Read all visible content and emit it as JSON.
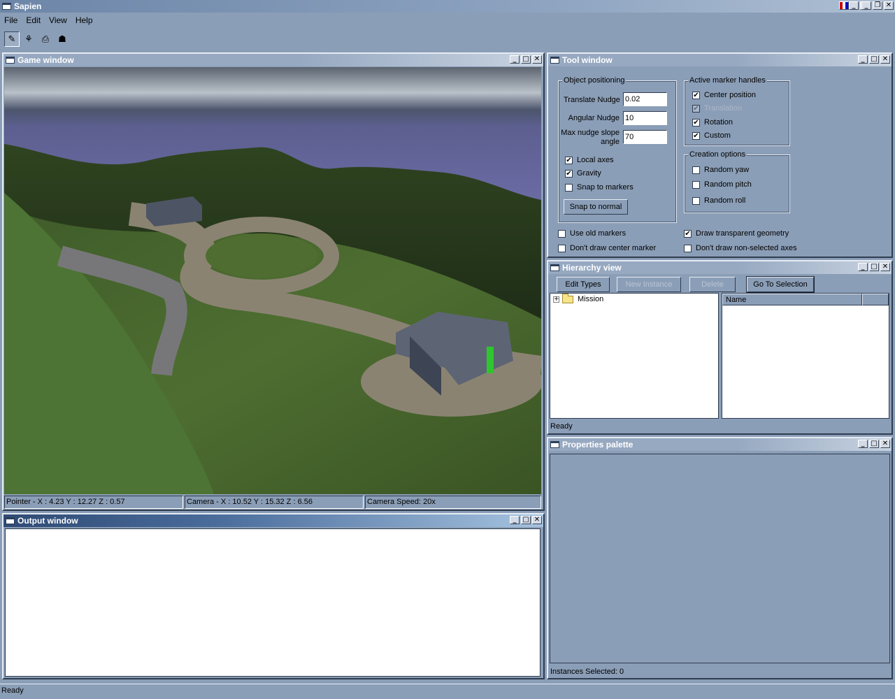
{
  "app": {
    "title": "Sapien",
    "status": "Ready"
  },
  "menu": [
    "File",
    "Edit",
    "View",
    "Help"
  ],
  "toolbar": {
    "icons": [
      "pencil-icon",
      "plant-icon",
      "camera-icon",
      "figure-icon"
    ]
  },
  "game_window": {
    "title": "Game window",
    "status": {
      "pointer": "Pointer - X : 4.23  Y : 12.27  Z : 0.57",
      "camera": "Camera - X : 10.52  Y : 15.32  Z : 6.56",
      "speed": "Camera Speed: 20x"
    }
  },
  "output_window": {
    "title": "Output window"
  },
  "tool_window": {
    "title": "Tool window",
    "object_positioning": {
      "label": "Object positioning",
      "translate_nudge_label": "Translate Nudge",
      "translate_nudge_value": "0.02",
      "angular_nudge_label": "Angular Nudge",
      "angular_nudge_value": "10",
      "max_slope_label_1": "Max nudge slope",
      "max_slope_label_2": "angle",
      "max_slope_value": "70",
      "local_axes": "Local axes",
      "gravity": "Gravity",
      "snap_to_markers": "Snap to markers",
      "snap_to_normal": "Snap to normal"
    },
    "active_marker_handles": {
      "label": "Active marker handles",
      "center_position": "Center position",
      "translation": "Translation",
      "rotation": "Rotation",
      "custom": "Custom"
    },
    "creation_options": {
      "label": "Creation options",
      "random_yaw": "Random yaw",
      "random_pitch": "Random pitch",
      "random_roll": "Random roll"
    },
    "use_old_markers": "Use old markers",
    "dont_draw_center_marker": "Don't draw center marker",
    "draw_transparent_geometry": "Draw transparent geometry",
    "dont_draw_non_selected_axes": "Don't draw non-selected axes"
  },
  "hierarchy_view": {
    "title": "Hierarchy view",
    "buttons": {
      "edit_types": "Edit Types",
      "new_instance": "New Instance",
      "delete": "Delete",
      "go_to_selection": "Go To Selection"
    },
    "tree_root": "Mission",
    "list_column": "Name",
    "status": "Ready"
  },
  "properties_palette": {
    "title": "Properties palette",
    "status": "Instances Selected: 0"
  }
}
